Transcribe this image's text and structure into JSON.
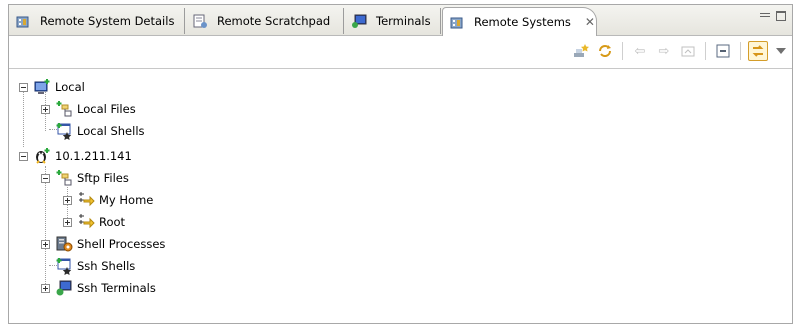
{
  "tabs": [
    {
      "label": "Remote System Details",
      "icon": "remote-system-details-icon"
    },
    {
      "label": "Remote Scratchpad",
      "icon": "scratchpad-icon"
    },
    {
      "label": "Terminals",
      "icon": "terminals-icon"
    },
    {
      "label": "Remote Systems",
      "icon": "remote-systems-icon",
      "active": true
    }
  ],
  "tree": {
    "local": "Local",
    "local_files": "Local Files",
    "local_shells": "Local Shells",
    "host": "10.1.211.141",
    "sftp_files": "Sftp Files",
    "my_home": "My Home",
    "root": "Root",
    "shell_processes": "Shell Processes",
    "ssh_shells": "Ssh Shells",
    "ssh_terminals": "Ssh Terminals"
  },
  "colors": {
    "accent": "#d49d2a",
    "border": "#a8a8a8"
  }
}
